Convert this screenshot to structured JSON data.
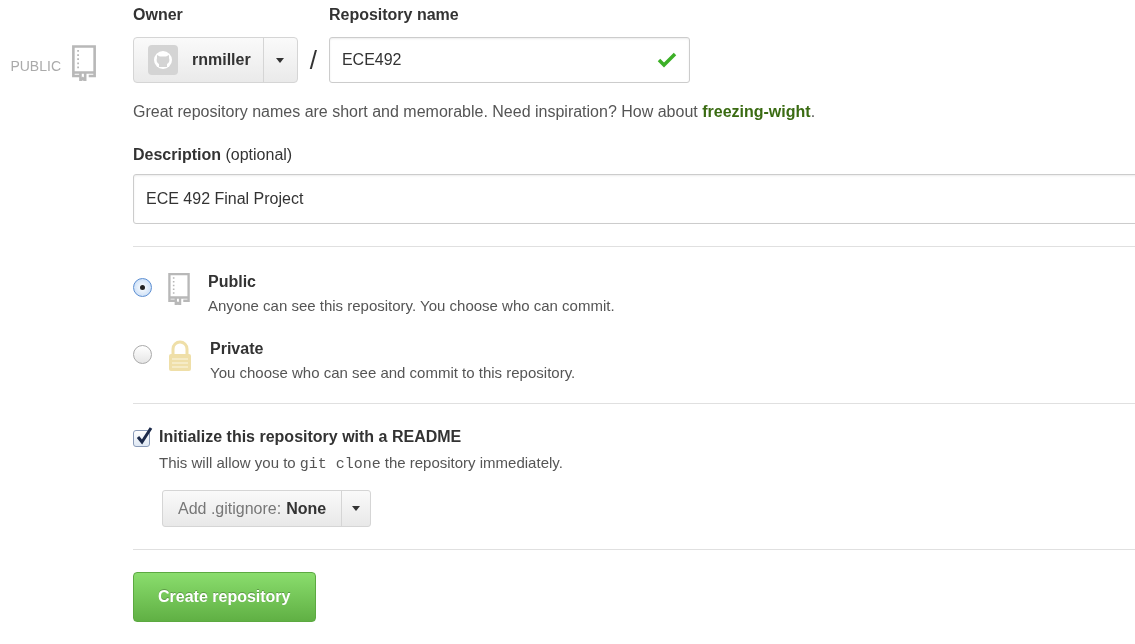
{
  "visibility_badge": {
    "label": "PUBLIC"
  },
  "owner": {
    "label": "Owner",
    "value": "rnmiller"
  },
  "separator": "/",
  "repository_name": {
    "label": "Repository name",
    "value": "ECE492",
    "valid": true
  },
  "name_hint": "Great repository names are short and memorable. Need inspiration? How about **freezing-wight**.",
  "description": {
    "label": "Description",
    "label_note": "(optional)",
    "value": "ECE 492 Final Project"
  },
  "visibility_options": [
    {
      "kind": "public",
      "title": "Public",
      "hint": "Anyone can see this repository. You choose who can commit.",
      "selected": true
    },
    {
      "kind": "private",
      "title": "Private",
      "hint": "You choose who can see and commit to this repository.",
      "selected": false
    }
  ],
  "readme": {
    "label": "Initialize this repository with a README",
    "checked": true,
    "hint_before": "This will allow you to",
    "hint_code": "git clone",
    "hint_after": "the repository immediately."
  },
  "gitignore": {
    "label": "Add .gitignore:",
    "value": "None"
  },
  "submit": "Create repository"
}
